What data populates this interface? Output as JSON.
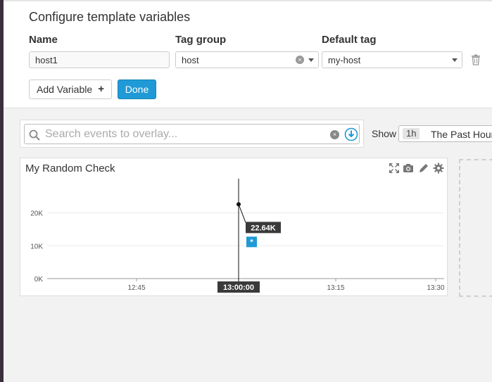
{
  "template_vars": {
    "title": "Configure template variables",
    "columns": {
      "name": "Name",
      "tag_group": "Tag group",
      "default_tag": "Default tag"
    },
    "row": {
      "name": "host1",
      "tag_group": "host",
      "default_tag": "my-host"
    },
    "add_variable_label": "Add Variable",
    "done_label": "Done"
  },
  "search": {
    "placeholder": "Search events to overlay..."
  },
  "timeframe": {
    "show_label": "Show",
    "code": "1h",
    "label": "The Past Hour"
  },
  "widget": {
    "title": "My Random Check"
  },
  "chart_data": {
    "type": "line",
    "title": "My Random Check",
    "x_ticks": [
      "12:45",
      "13:00:00",
      "13:15",
      "13:30"
    ],
    "y_ticks": [
      "0K",
      "10K",
      "20K"
    ],
    "ylim": [
      0,
      30000
    ],
    "series": [
      {
        "x": [
          "13:00:00"
        ],
        "values": [
          22640
        ]
      }
    ],
    "tooltip": {
      "value_label": "22.64K",
      "marker": "*",
      "time_label": "13:00:00"
    },
    "grid": true
  },
  "colors": {
    "accent": "#1f9ad6",
    "line": "#000000",
    "tooltip_bg": "#3a3a3a"
  }
}
